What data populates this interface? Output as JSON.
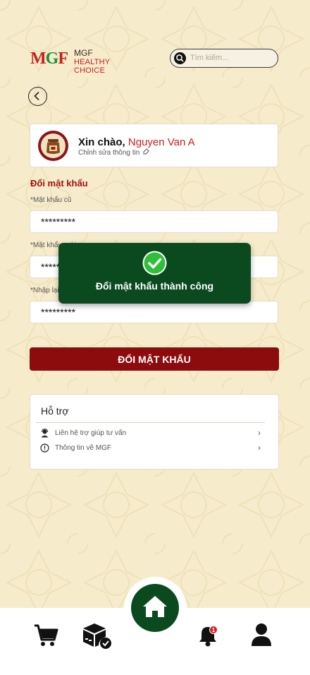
{
  "header": {
    "brand": "MGF",
    "slogan": "HEALTHY CHOICE",
    "search_placeholder": "Tìm kiếm..."
  },
  "profile": {
    "greeting": "Xin chào,",
    "name": "Nguyen Van A",
    "edit_label": "Chỉnh sửa thông tin"
  },
  "form": {
    "title": "Đổi mật khẩu",
    "old_password_label": "*Mật khẩu cũ",
    "new_password_label": "*Mật khẩu mới",
    "confirm_password_label": "*Nhập lại mật khẩu mới",
    "old_password_value": "*********",
    "new_password_value": "*********",
    "confirm_password_value": "*********",
    "submit_label": "ĐỔI MẬT KHẨU"
  },
  "support": {
    "title": "Hỗ trợ",
    "items": [
      {
        "label": "Liên hệ trợ giúp tư vấn",
        "icon": "support-agent-icon"
      },
      {
        "label": "Thông tin về MGF",
        "icon": "info-icon"
      }
    ]
  },
  "toast": {
    "message": "Đổi mật khẩu thành công"
  },
  "bottom_nav": {
    "notification_badge": "1",
    "items": [
      "cart-icon",
      "orders-icon",
      "home-icon",
      "bell-icon",
      "user-icon"
    ]
  },
  "colors": {
    "brand_red": "#8c0b0d",
    "brand_green": "#0b4a1f",
    "background": "#f6eccc"
  }
}
